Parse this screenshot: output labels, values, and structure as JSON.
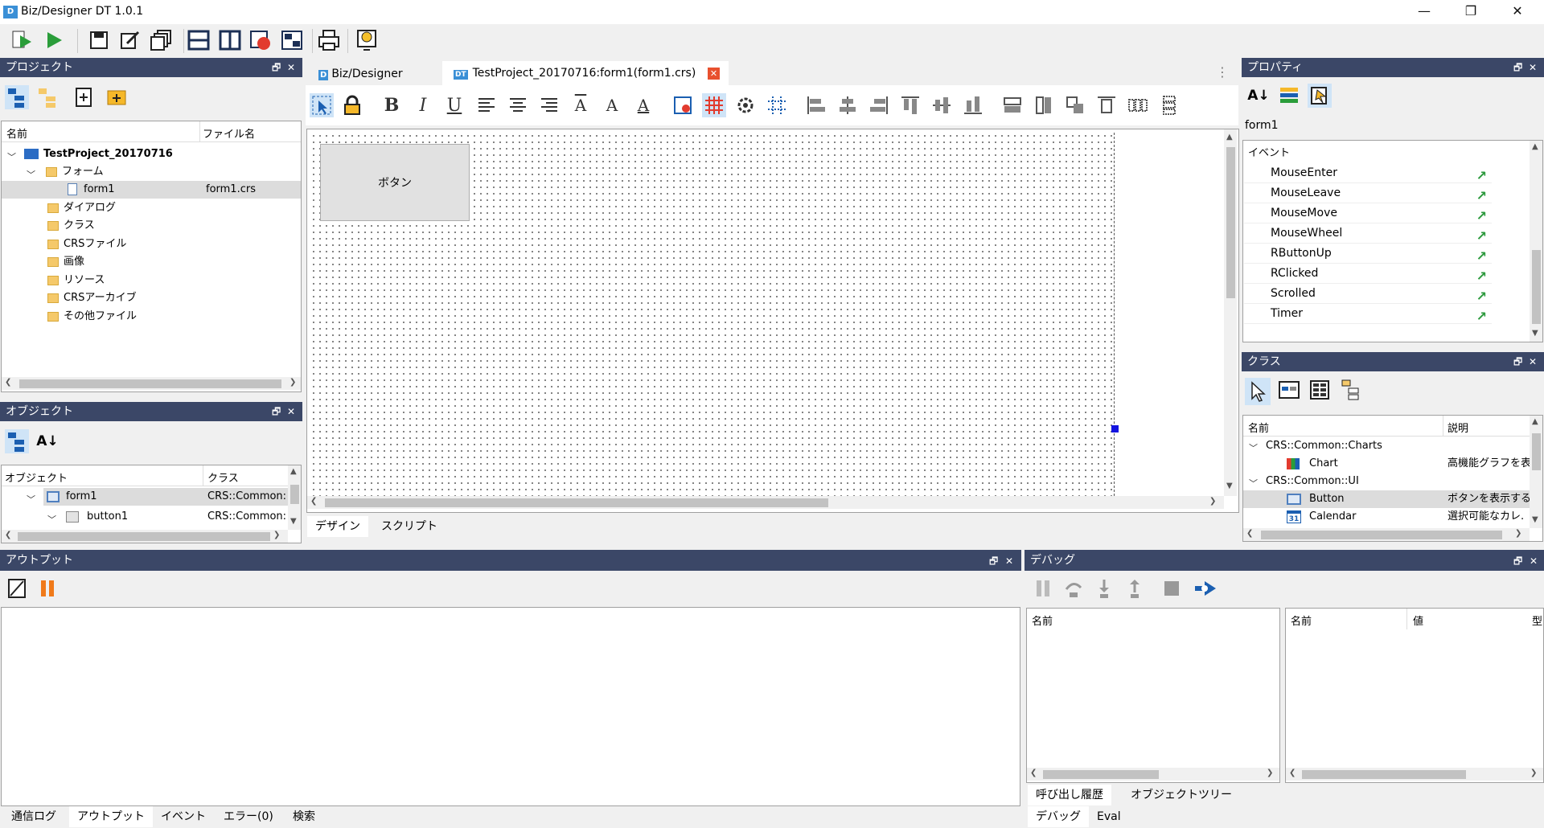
{
  "window": {
    "title": "Biz/Designer DT 1.0.1",
    "icon_text": "D",
    "controls": {
      "minimize": "—",
      "restore": "❐",
      "close": "✕"
    }
  },
  "project_panel": {
    "title": "プロジェクト",
    "col_name": "名前",
    "col_file": "ファイル名",
    "root": "TestProject_20170716",
    "forms_folder": "フォーム",
    "form_item": {
      "name": "form1",
      "file": "form1.crs"
    },
    "folders": [
      "ダイアログ",
      "クラス",
      "CRSファイル",
      "画像",
      "リソース",
      "CRSアーカイブ",
      "その他ファイル"
    ]
  },
  "object_panel": {
    "title": "オブジェクト",
    "col_object": "オブジェクト",
    "col_class": "クラス",
    "rows": [
      {
        "name": "form1",
        "class": "CRS::Common:"
      },
      {
        "name": "button1",
        "class": "CRS::Common:"
      }
    ]
  },
  "editor": {
    "tabs": [
      {
        "icon": "D",
        "label": "Biz/Designer"
      },
      {
        "icon": "DT",
        "label": "TestProject_20170716:form1(form1.crs)"
      }
    ],
    "canvas_button_label": "ボタン",
    "bottom_tabs": [
      "デザイン",
      "スクリプト"
    ],
    "format_buttons": {
      "bold": "B",
      "italic": "I",
      "underline": "U",
      "text_a": "A"
    }
  },
  "properties_panel": {
    "title": "プロパティ",
    "object_name": "form1",
    "section": "イベント",
    "events": [
      "MouseEnter",
      "MouseLeave",
      "MouseMove",
      "MouseWheel",
      "RButtonUp",
      "RClicked",
      "Scrolled",
      "Timer"
    ]
  },
  "class_panel": {
    "title": "クラス",
    "col_name": "名前",
    "col_desc": "説明",
    "group1": "CRS::Common::Charts",
    "chart": {
      "name": "Chart",
      "desc": "高機能グラフを表"
    },
    "group2": "CRS::Common::UI",
    "button": {
      "name": "Button",
      "desc": "ボタンを表示する"
    },
    "calendar": {
      "name": "Calendar",
      "desc": "選択可能なカレ.",
      "icon_text": "31"
    }
  },
  "output_panel": {
    "title": "アウトプット",
    "tabs": [
      "通信ログ",
      "アウトプット",
      "イベント",
      "エラー(0)",
      "検索"
    ]
  },
  "debug_panel": {
    "title": "デバッグ",
    "left_col": "名前",
    "right_col_name": "名前",
    "right_col_value": "値",
    "right_col_more": "型",
    "subtabs": [
      "呼び出し履歴",
      "オブジェクトツリー"
    ],
    "tabs": [
      "デバッグ",
      "Eval"
    ]
  },
  "colors": {
    "panel_header": "#3b4767",
    "accent_blue": "#1a5fb4",
    "pause_orange": "#f07a1a",
    "event_green": "#2d9a3e"
  }
}
